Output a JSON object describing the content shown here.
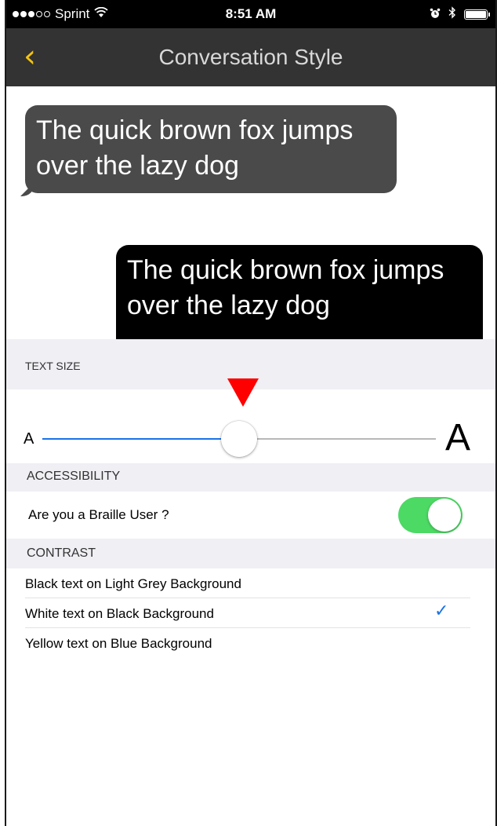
{
  "status_bar": {
    "carrier": "Sprint",
    "signal": {
      "filled": 3,
      "total": 5
    },
    "wifi_icon": "wifi-icon",
    "time": "8:51 AM",
    "alarm_icon": "alarm-clock-icon",
    "bluetooth_icon": "bluetooth-icon",
    "battery_level": 1.0
  },
  "nav": {
    "back_icon": "chevron-left-icon",
    "back_glyph": "‹",
    "title": "Conversation Style"
  },
  "preview": {
    "incoming_text": "The quick brown fox jumps over the lazy dog",
    "outgoing_text": "The quick brown fox jumps over the lazy dog"
  },
  "text_size": {
    "header": "TEXT SIZE",
    "small_label": "A",
    "large_label": "A",
    "value": 0.5,
    "marker_icon": "triangle-down-marker"
  },
  "accessibility": {
    "header": "ACCESSIBILITY",
    "braille_label": "Are you a Braille User ?",
    "braille_enabled": true
  },
  "contrast": {
    "header": "CONTRAST",
    "options": [
      {
        "label": "Black text on Light Grey Background",
        "selected": false
      },
      {
        "label": "White text on Black Background",
        "selected": true
      },
      {
        "label": "Yellow text on Blue Background",
        "selected": false
      }
    ],
    "check_glyph": "✓"
  },
  "colors": {
    "nav_background": "#333333",
    "accent_yellow": "#f5c30f",
    "slider_blue": "#1a73e8",
    "toggle_green": "#4cd964",
    "check_blue": "#1a73e8",
    "marker_red": "#ff0000"
  }
}
